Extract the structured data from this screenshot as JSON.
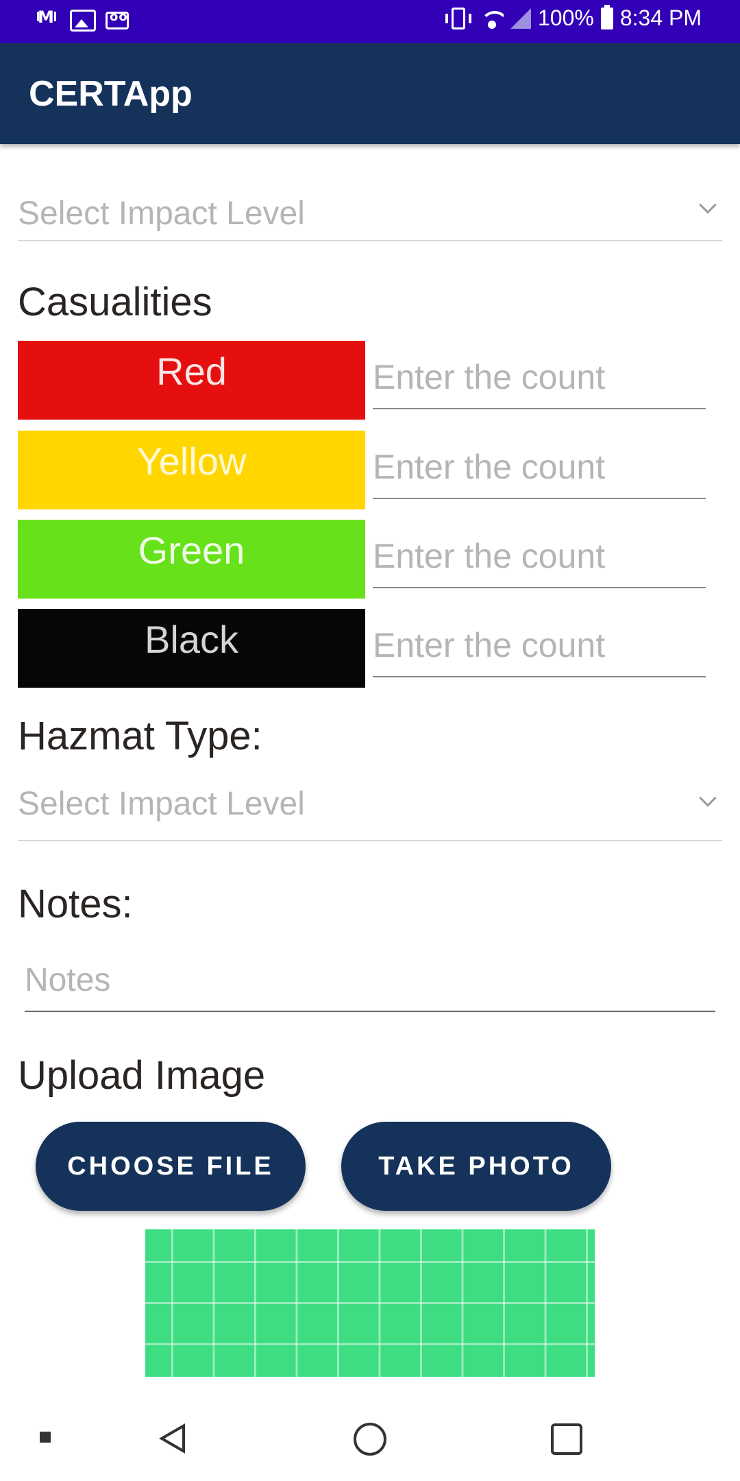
{
  "status_bar": {
    "battery": "100%",
    "time": "8:34 PM"
  },
  "app_bar": {
    "title": "CERTApp"
  },
  "impact_dropdown": {
    "placeholder": "Select Impact Level"
  },
  "casualties": {
    "label": "Casualities",
    "rows": [
      {
        "tag": "Red",
        "color": "#e60f10",
        "text_color": "#fbe4e4",
        "placeholder": "Enter the count"
      },
      {
        "tag": "Yellow",
        "color": "#ffd600",
        "text_color": "#fff8d6",
        "placeholder": "Enter the count"
      },
      {
        "tag": "Green",
        "color": "#66e11a",
        "text_color": "#eefbe6",
        "placeholder": "Enter the count"
      },
      {
        "tag": "Black",
        "color": "#060606",
        "text_color": "#d4d4d4",
        "placeholder": "Enter the count"
      }
    ]
  },
  "hazmat": {
    "label": "Hazmat Type:",
    "placeholder": "Select Impact Level"
  },
  "notes": {
    "label": "Notes:",
    "placeholder": "Notes"
  },
  "upload": {
    "label": "Upload Image",
    "choose_file": "CHOOSE FILE",
    "take_photo": "TAKE PHOTO"
  }
}
